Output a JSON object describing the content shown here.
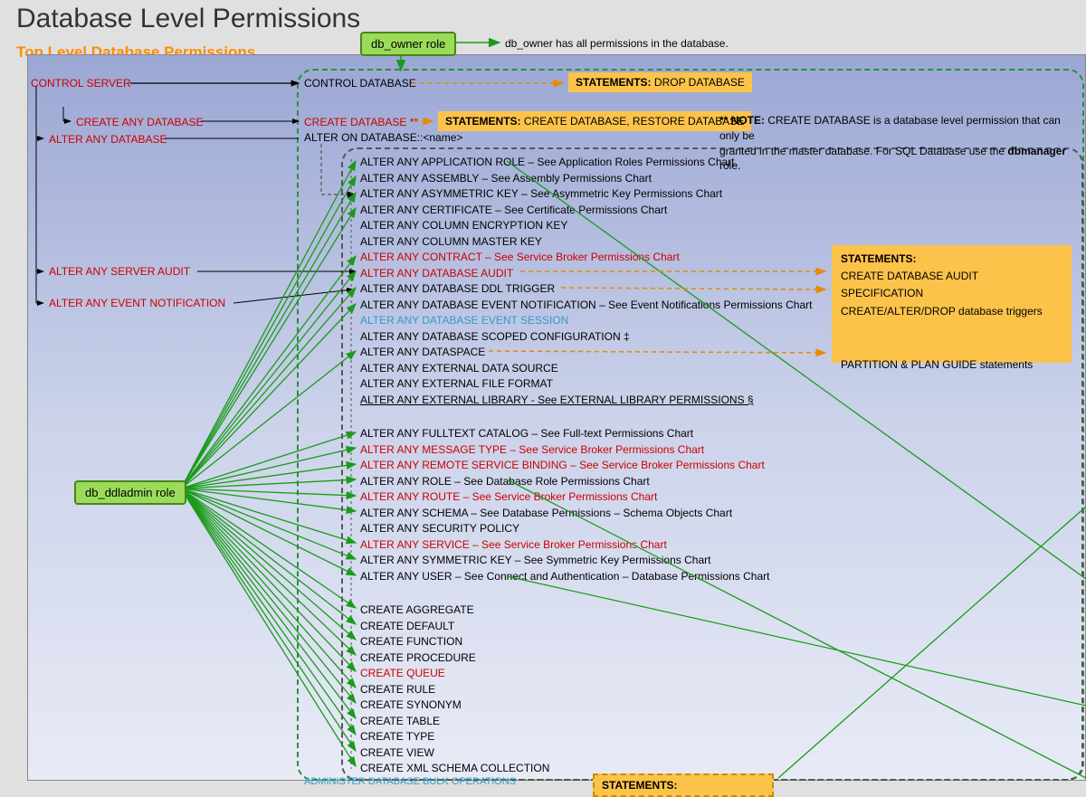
{
  "title": "Database Level Permissions",
  "section_title": "Top Level Database Permissions",
  "db_owner_role": "db_owner role",
  "db_owner_note": "db_owner has all permissions in the database.",
  "db_ddladmin_role": "db_ddladmin role",
  "server_perms": {
    "control_server": "CONTROL SERVER",
    "create_any_db": "CREATE ANY DATABASE",
    "alter_any_db": "ALTER ANY DATABASE",
    "alter_any_server_audit": "ALTER ANY SERVER AUDIT",
    "alter_any_event_notification": "ALTER ANY EVENT NOTIFICATION"
  },
  "top": {
    "control_database": "CONTROL DATABASE",
    "create_database": "CREATE DATABASE",
    "create_db_star": " **",
    "alter_on_database": "ALTER ON DATABASE::<name>"
  },
  "stmt_drop": "STATEMENTS:",
  "stmt_drop_text": " DROP DATABASE",
  "stmt_create": "STATEMENTS:",
  "stmt_create_text": " CREATE DATABASE, RESTORE DATABASE",
  "note_star": "** NOTE:",
  "note_text1": " CREATE DATABASE is a database level permission that can only be",
  "note_text2": "granted in the master database. For SQL Database use the ",
  "note_text3": "dbmanager",
  "note_text4": " role.",
  "alter_list": [
    {
      "t": "ALTER ANY APPLICATION ROLE – See Application Roles Permissions Chart",
      "c": "black"
    },
    {
      "t": "ALTER ANY ASSEMBLY – See Assembly Permissions Chart",
      "c": "black"
    },
    {
      "t": "ALTER ANY ASYMMETRIC KEY – See Asymmetric Key Permissions Chart",
      "c": "black"
    },
    {
      "t": "ALTER ANY CERTIFICATE – See Certificate Permissions Chart",
      "c": "black"
    },
    {
      "t": "ALTER ANY COLUMN ENCRYPTION KEY",
      "c": "black"
    },
    {
      "t": "ALTER ANY COLUMN MASTER KEY",
      "c": "black"
    },
    {
      "t": "ALTER ANY CONTRACT – See Service Broker Permissions Chart",
      "c": "red"
    },
    {
      "t": "ALTER ANY DATABASE AUDIT",
      "c": "red"
    },
    {
      "t": "ALTER ANY DATABASE DDL TRIGGER",
      "c": "black"
    },
    {
      "t": "ALTER ANY DATABASE EVENT NOTIFICATION – See Event Notifications Permissions Chart",
      "c": "black"
    },
    {
      "t": "ALTER ANY DATABASE EVENT SESSION",
      "c": "blue"
    },
    {
      "t": "ALTER ANY DATABASE SCOPED CONFIGURATION ‡",
      "c": "black"
    },
    {
      "t": "ALTER ANY DATASPACE",
      "c": "black"
    },
    {
      "t": "ALTER ANY EXTERNAL DATA SOURCE",
      "c": "black"
    },
    {
      "t": "ALTER ANY EXTERNAL FILE FORMAT",
      "c": "black"
    },
    {
      "t": "ALTER ANY EXTERNAL LIBRARY - See EXTERNAL LIBRARY PERMISSIONS §",
      "c": "black",
      "u": true
    }
  ],
  "alter_list2": [
    {
      "t": "ALTER ANY FULLTEXT CATALOG – See Full-text Permissions Chart",
      "c": "black"
    },
    {
      "t": "ALTER ANY MESSAGE TYPE – See Service Broker Permissions Chart",
      "c": "red"
    },
    {
      "t": "ALTER ANY REMOTE SERVICE BINDING – See Service Broker Permissions Chart",
      "c": "red"
    },
    {
      "t": "ALTER ANY ROLE – See Database Role Permissions Chart",
      "c": "black"
    },
    {
      "t": "ALTER ANY ROUTE – See Service Broker Permissions Chart",
      "c": "red"
    },
    {
      "t": "ALTER ANY SCHEMA – See Database Permissions – Schema Objects Chart",
      "c": "black"
    },
    {
      "t": "ALTER ANY SECURITY POLICY",
      "c": "black"
    },
    {
      "t": "ALTER ANY SERVICE – See Service Broker Permissions Chart",
      "c": "red"
    },
    {
      "t": "ALTER ANY SYMMETRIC KEY – See Symmetric Key Permissions Chart",
      "c": "black"
    },
    {
      "t": "ALTER ANY USER – See Connect and Authentication – Database Permissions Chart",
      "c": "black"
    }
  ],
  "create_list": [
    {
      "t": "CREATE AGGREGATE",
      "c": "black"
    },
    {
      "t": "CREATE DEFAULT",
      "c": "black"
    },
    {
      "t": "CREATE FUNCTION",
      "c": "black"
    },
    {
      "t": "CREATE PROCEDURE",
      "c": "black"
    },
    {
      "t": "CREATE QUEUE",
      "c": "red"
    },
    {
      "t": "CREATE RULE",
      "c": "black"
    },
    {
      "t": "CREATE SYNONYM",
      "c": "black"
    },
    {
      "t": "CREATE TABLE",
      "c": "black"
    },
    {
      "t": "CREATE TYPE",
      "c": "black"
    },
    {
      "t": "CREATE VIEW",
      "c": "black"
    },
    {
      "t": "CREATE XML SCHEMA COLLECTION",
      "c": "black"
    }
  ],
  "admin_bulk": "ADMINISTER DATABASE BULK OPERATIONS",
  "stmt_right": {
    "header": "STATEMENTS:",
    "l1": "CREATE DATABASE AUDIT SPECIFICATION",
    "l2": "CREATE/ALTER/DROP database triggers",
    "l3": "PARTITION & PLAN GUIDE statements"
  },
  "stmt_bottom": "STATEMENTS:"
}
